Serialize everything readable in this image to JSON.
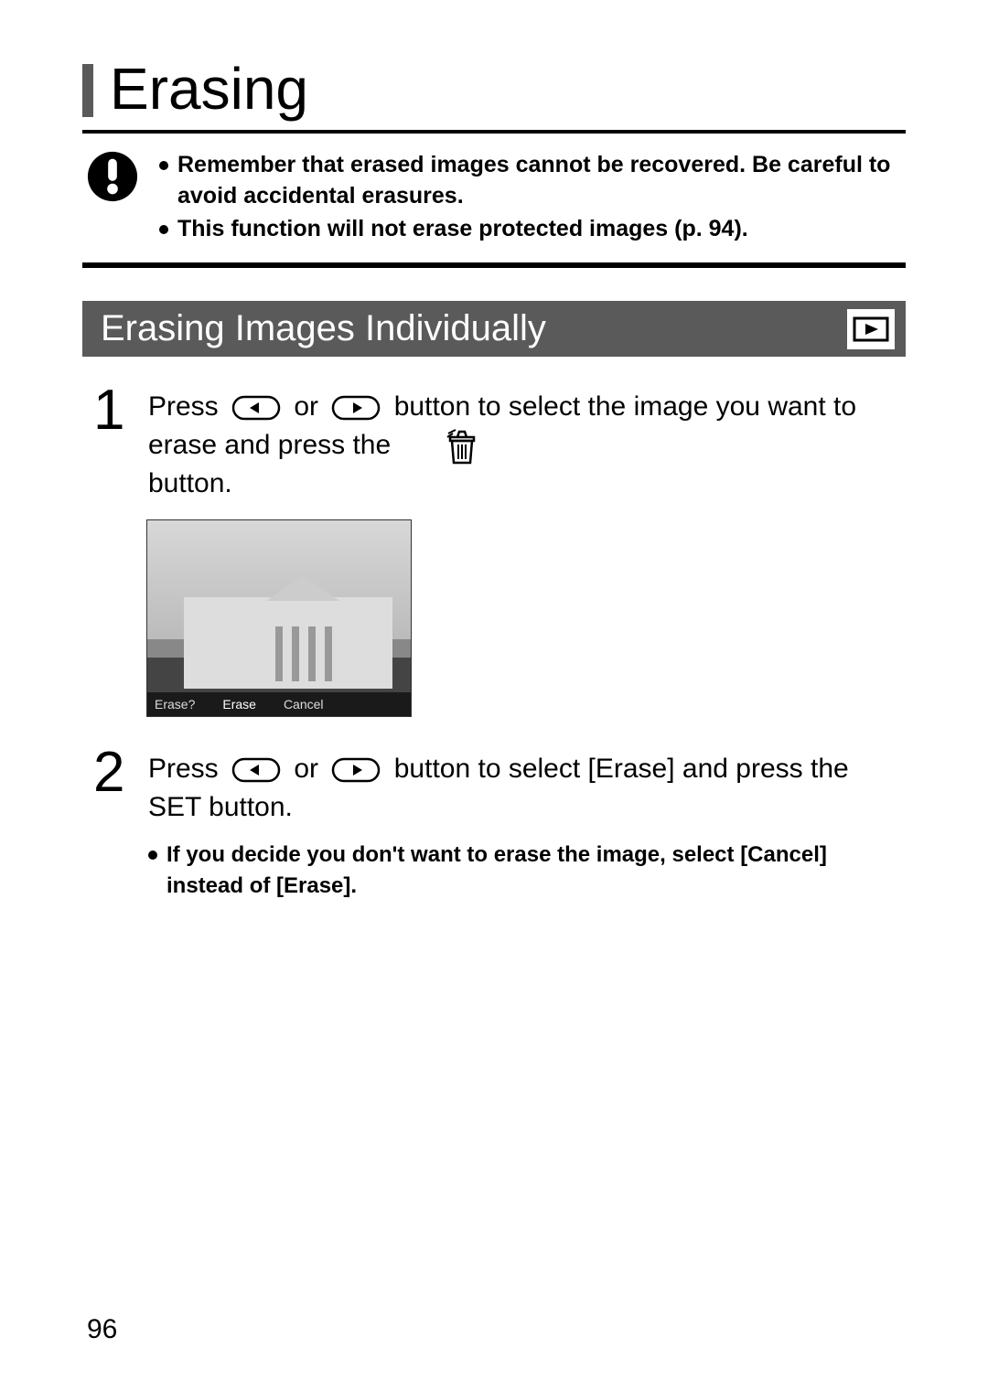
{
  "title": "Erasing",
  "warnings": [
    "Remember that erased images cannot be recovered. Be careful to avoid accidental erasures.",
    "This function will not erase protected images (p. 94)."
  ],
  "section": {
    "title": "Erasing Images Individually"
  },
  "steps": [
    {
      "number": "1",
      "prefix": "Press ",
      "mid": " or ",
      "after_buttons": " button to select the image you want to erase and press the ",
      "suffix": " button."
    },
    {
      "number": "2",
      "prefix": "Press ",
      "mid": " or ",
      "after_buttons": " button to select [Erase] and press the SET button.",
      "note": "If you decide you don't want to erase the image, select [Cancel] instead of [Erase]."
    }
  ],
  "screenshot": {
    "prompt": "Erase?",
    "option_erase": "Erase",
    "option_cancel": "Cancel"
  },
  "page_number": "96"
}
